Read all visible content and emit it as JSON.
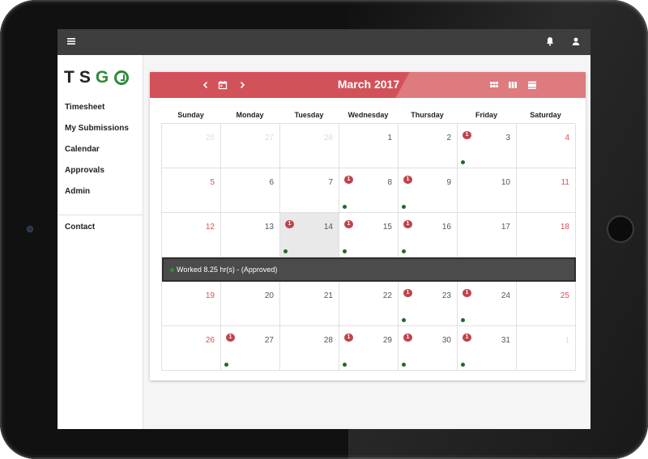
{
  "app": {
    "logo_text": "TSGO",
    "brand_color": "#2e8b3a",
    "accent_color": "#d2525a"
  },
  "topbar": {
    "menu_icon": "menu-icon",
    "notification_icon": "bell-icon",
    "account_icon": "user-icon"
  },
  "sidebar": {
    "items": [
      {
        "label": "Timesheet"
      },
      {
        "label": "My Submissions"
      },
      {
        "label": "Calendar"
      },
      {
        "label": "Approvals"
      },
      {
        "label": "Admin"
      },
      {
        "label": "Contact"
      }
    ]
  },
  "calendar": {
    "title": "March 2017",
    "prev_icon": "chevron-left-icon",
    "today_icon": "calendar-icon",
    "next_icon": "chevron-right-icon",
    "views": [
      "month-view-icon",
      "week-view-icon",
      "day-view-icon"
    ],
    "weekdays": [
      "Sunday",
      "Monday",
      "Tuesday",
      "Wednesday",
      "Thursday",
      "Friday",
      "Saturday"
    ],
    "weeks": [
      [
        {
          "day": "26",
          "muted": true
        },
        {
          "day": "27",
          "muted": true
        },
        {
          "day": "28",
          "muted": true
        },
        {
          "day": "1"
        },
        {
          "day": "2"
        },
        {
          "day": "3",
          "badge": "1",
          "dot": true
        },
        {
          "day": "4",
          "weekend": true
        }
      ],
      [
        {
          "day": "5",
          "weekend": true
        },
        {
          "day": "6"
        },
        {
          "day": "7"
        },
        {
          "day": "8",
          "badge": "1",
          "dot": true
        },
        {
          "day": "9",
          "badge": "1",
          "dot": true
        },
        {
          "day": "10"
        },
        {
          "day": "11",
          "weekend": true
        }
      ],
      [
        {
          "day": "12",
          "weekend": true
        },
        {
          "day": "13"
        },
        {
          "day": "14",
          "badge": "1",
          "dot": true,
          "today": true
        },
        {
          "day": "15",
          "badge": "1",
          "dot": true
        },
        {
          "day": "16",
          "badge": "1",
          "dot": true
        },
        {
          "day": "17"
        },
        {
          "day": "18",
          "weekend": true
        }
      ],
      [
        {
          "day": "19",
          "weekend": true
        },
        {
          "day": "20"
        },
        {
          "day": "21"
        },
        {
          "day": "22"
        },
        {
          "day": "23",
          "badge": "1",
          "dot": true
        },
        {
          "day": "24",
          "badge": "1",
          "dot": true
        },
        {
          "day": "25",
          "weekend": true
        }
      ],
      [
        {
          "day": "26",
          "weekend": true
        },
        {
          "day": "27",
          "badge": "1",
          "dot": true
        },
        {
          "day": "28"
        },
        {
          "day": "29",
          "badge": "1",
          "dot": true
        },
        {
          "day": "30",
          "badge": "1",
          "dot": true
        },
        {
          "day": "31",
          "badge": "1",
          "dot": true
        },
        {
          "day": "1",
          "muted": true
        }
      ]
    ],
    "detail": {
      "after_week": 2,
      "text": "Worked 8.25 hr(s) - (Approved)"
    }
  }
}
